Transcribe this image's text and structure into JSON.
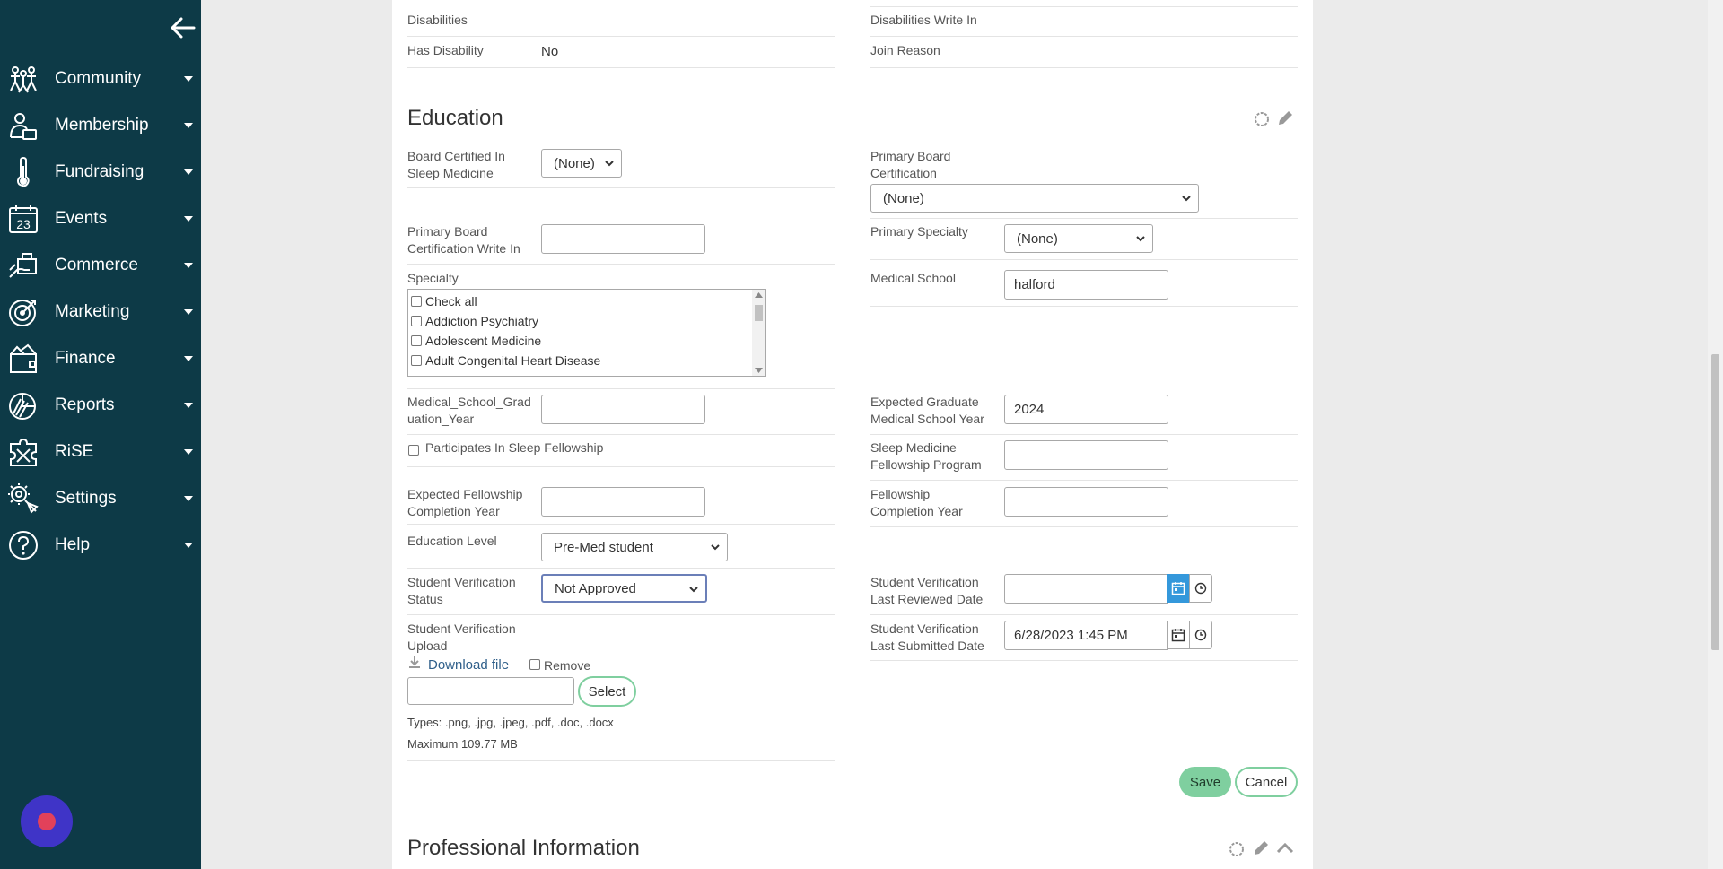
{
  "colors": {
    "sidebar": "#0d3a47",
    "accent_green": "#7fcf9f",
    "accent_blue": "#3498db",
    "bubble": "#3f34c7",
    "bubble_dot": "#e2415a"
  },
  "sidebar": {
    "items": [
      {
        "label": "Community",
        "icon": "community-icon"
      },
      {
        "label": "Membership",
        "icon": "membership-icon"
      },
      {
        "label": "Fundraising",
        "icon": "thermometer-icon"
      },
      {
        "label": "Events",
        "icon": "calendar-icon"
      },
      {
        "label": "Commerce",
        "icon": "commerce-icon"
      },
      {
        "label": "Marketing",
        "icon": "target-icon"
      },
      {
        "label": "Finance",
        "icon": "finance-icon"
      },
      {
        "label": "Reports",
        "icon": "reports-icon"
      },
      {
        "label": "RiSE",
        "icon": "puzzle-icon"
      },
      {
        "label": "Settings",
        "icon": "settings-icon"
      },
      {
        "label": "Help",
        "icon": "help-icon"
      }
    ],
    "calendar_number": "23"
  },
  "top_rows": {
    "disabilities": "Disabilities",
    "disabilities_write_in": "Disabilities Write In",
    "has_disability": "Has Disability",
    "has_disability_value": "No",
    "join_reason": "Join Reason"
  },
  "education": {
    "title": "Education",
    "board_certified_label": "Board Certified In Sleep Medicine",
    "board_certified_value": "(None)",
    "primary_board_cert_label": "Primary Board Certification",
    "primary_board_cert_value": "(None)",
    "primary_board_cert_write_in_label": "Primary Board Certification Write In",
    "primary_board_cert_write_in_value": "",
    "primary_specialty_label": "Primary Specialty",
    "primary_specialty_value": "(None)",
    "specialty_label": "Specialty",
    "specialty_options": [
      "Check all",
      "Addiction Psychiatry",
      "Adolescent Medicine",
      "Adult Congenital Heart Disease"
    ],
    "medical_school_label": "Medical School",
    "medical_school_value": "halford",
    "grad_year_label": "Medical_School_Graduation_Year",
    "grad_year_value": "",
    "expected_grad_label": "Expected Graduate Medical School Year",
    "expected_grad_value": "2024",
    "sleep_fellowship_label": "Participates In Sleep Fellowship",
    "sleep_fellowship_program_label": "Sleep Medicine Fellowship Program",
    "sleep_fellowship_program_value": "",
    "expected_fellowship_label": "Expected Fellowship Completion Year",
    "expected_fellowship_value": "",
    "fellowship_completion_label": "Fellowship Completion Year",
    "fellowship_completion_value": "",
    "education_level_label": "Education Level",
    "education_level_value": "Pre-Med student",
    "sv_status_label": "Student Verification Status",
    "sv_status_value": "Not Approved",
    "sv_reviewed_label": "Student Verification Last Reviewed Date",
    "sv_reviewed_value": "",
    "sv_upload_label": "Student Verification Upload",
    "download_file": "Download file",
    "remove": "Remove",
    "select_button": "Select",
    "file_value": "",
    "types": "Types: .png, .jpg, .jpeg, .pdf, .doc, .docx",
    "maximum": "Maximum 109.77 MB",
    "sv_submitted_label": "Student Verification Last Submitted Date",
    "sv_submitted_value": "6/28/2023 1:45 PM",
    "save": "Save",
    "cancel": "Cancel"
  },
  "professional": {
    "title": "Professional Information"
  }
}
